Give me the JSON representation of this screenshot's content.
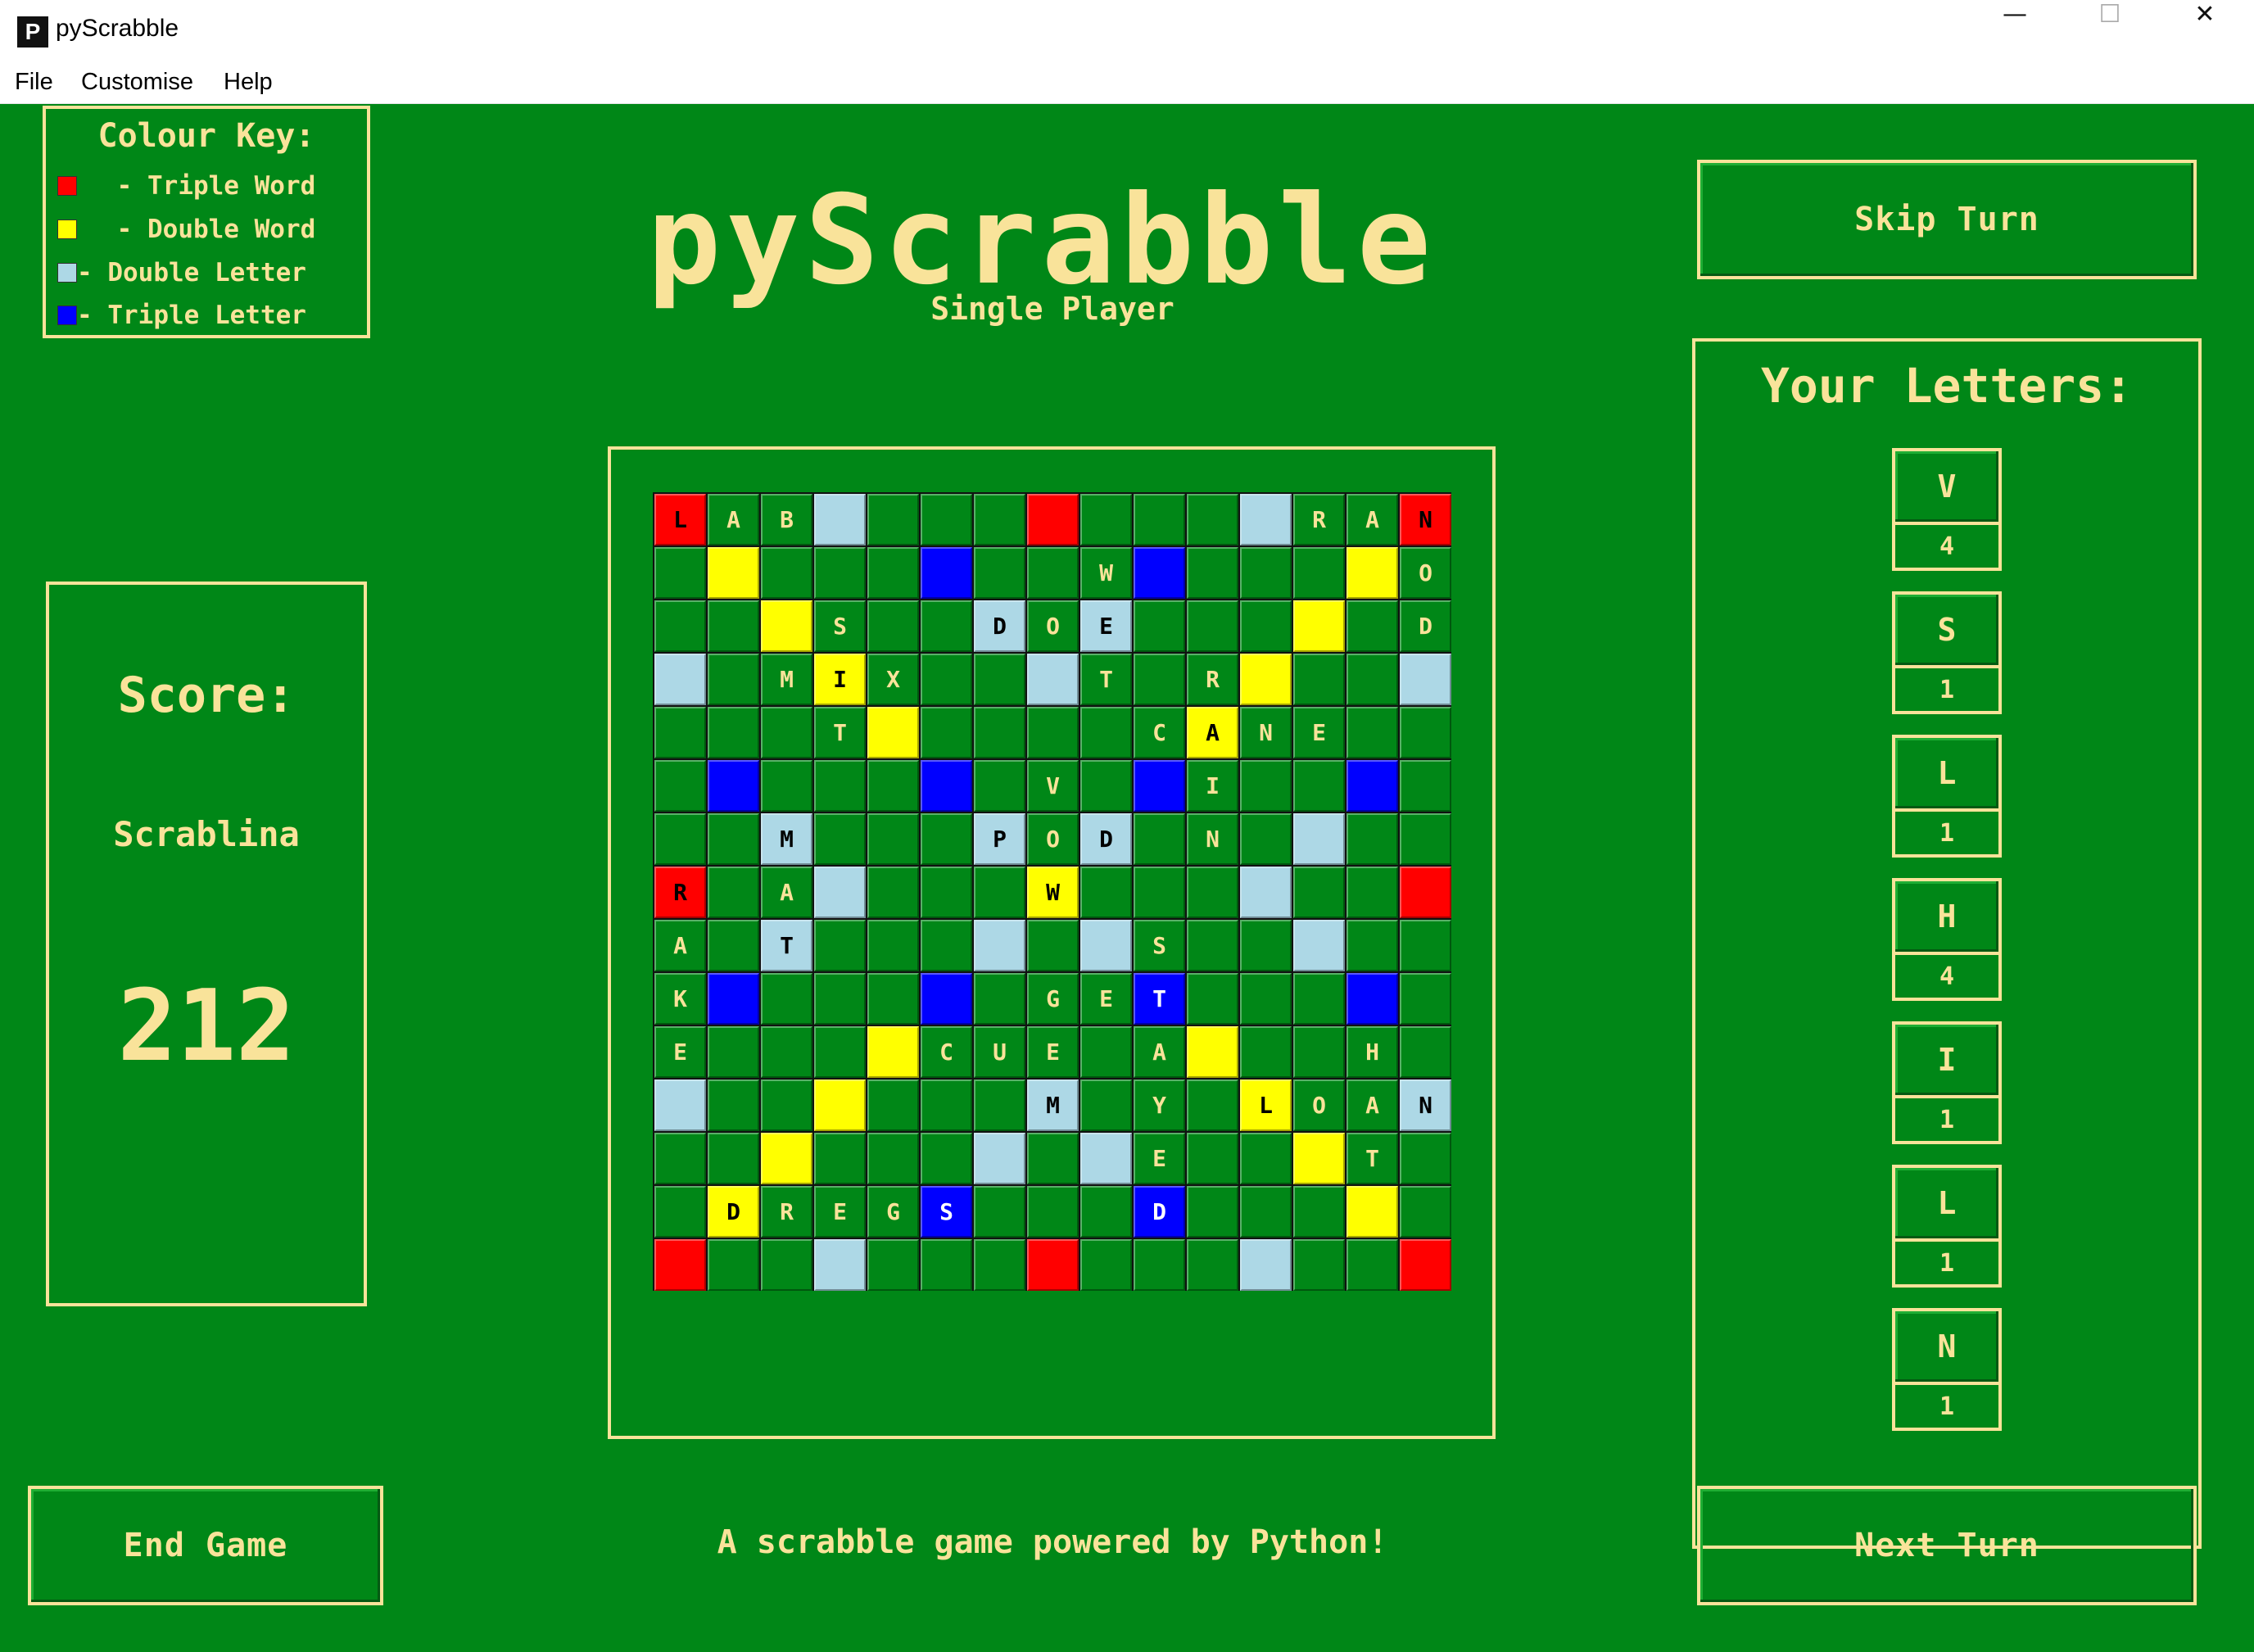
{
  "window": {
    "title": "pyScrabble",
    "icon_letter": "P",
    "controls": {
      "minimize": "—",
      "maximize": "☐",
      "close": "✕"
    }
  },
  "menu": {
    "items": [
      "File",
      "Customise",
      "Help"
    ]
  },
  "colour_key": {
    "title": "Colour Key:",
    "items": [
      {
        "label": " - Triple Word",
        "color": "#ff0000"
      },
      {
        "label": " - Double Word",
        "color": "#ffff00"
      },
      {
        "label": "- Double Letter",
        "color": "#add8e6"
      },
      {
        "label": "- Triple Letter",
        "color": "#0000ff"
      }
    ]
  },
  "header": {
    "title": "pyScrabble",
    "subtitle": "Single Player"
  },
  "score": {
    "label": "Score:",
    "player": "Scrablina",
    "value": "212"
  },
  "buttons": {
    "skip_turn": "Skip Turn",
    "end_game": "End Game",
    "next_turn": "Next Turn"
  },
  "letters": {
    "title": "Your Letters:",
    "tiles": [
      {
        "letter": "V",
        "score": "4"
      },
      {
        "letter": "S",
        "score": "1"
      },
      {
        "letter": "L",
        "score": "1"
      },
      {
        "letter": "H",
        "score": "4"
      },
      {
        "letter": "I",
        "score": "1"
      },
      {
        "letter": "L",
        "score": "1"
      },
      {
        "letter": "N",
        "score": "1"
      }
    ]
  },
  "footer": {
    "text": "A scrabble game powered by Python!"
  },
  "colors": {
    "background": "#008717",
    "cream": "#f9e39a",
    "cell_green": "#008717",
    "triple_word": "#ff0000",
    "double_word": "#ffff00",
    "double_letter": "#add8e6",
    "triple_letter": "#0000ff"
  },
  "board": {
    "rows": [
      "LAB...........RAN",
      "...............",
      "...............",
      "...............",
      "...............",
      "...............",
      "...............",
      "...............",
      "...............",
      "...............",
      "...............",
      "...............",
      "...............",
      "...............",
      "..............."
    ],
    "premium": [
      "T..d...T...d..T",
      ".D...t...t...D.",
      "..D...d.d...D..",
      "d..D...d...D..d",
      "....D.....D....",
      ".t...t...t...t.",
      "..d...d.d...d..",
      "T..d...D...d..T",
      "..d...d.d...d..",
      ".t...t...t...t.",
      "....D.....D....",
      "d..D...d...D..d",
      "..D...d.d...D..",
      ".D...t...t...D.",
      "T..d...T...d..T"
    ],
    "letters": [
      [
        "L",
        "A",
        "B",
        "",
        "",
        "",
        "",
        "",
        "",
        "",
        "",
        "",
        "R",
        "A",
        "N"
      ],
      [
        "",
        "",
        "",
        "",
        "",
        "",
        "",
        "",
        "W",
        "",
        "",
        "",
        "",
        "",
        "O"
      ],
      [
        "",
        "",
        "",
        "S",
        "",
        "",
        "D",
        "O",
        "E",
        "",
        "",
        "",
        "",
        "",
        "D"
      ],
      [
        "",
        "",
        "M",
        "I",
        "X",
        "",
        "",
        "",
        "T",
        "",
        "R",
        "",
        "",
        "",
        ""
      ],
      [
        "",
        "",
        "",
        "T",
        "",
        "",
        "",
        "",
        "",
        "C",
        "A",
        "N",
        "E",
        "",
        ""
      ],
      [
        "",
        "",
        "",
        "",
        "",
        "",
        "",
        "V",
        "",
        "",
        "I",
        "",
        "",
        "",
        ""
      ],
      [
        "",
        "",
        "M",
        "",
        "",
        "",
        "P",
        "O",
        "D",
        "",
        "N",
        "",
        "",
        "",
        ""
      ],
      [
        "R",
        "",
        "A",
        "",
        "",
        "",
        "",
        "W",
        "",
        "",
        "",
        "",
        "",
        "",
        ""
      ],
      [
        "A",
        "",
        "T",
        "",
        "",
        "",
        "",
        "",
        "",
        "S",
        "",
        "",
        "",
        "",
        ""
      ],
      [
        "K",
        "",
        "",
        "",
        "",
        "",
        "",
        "G",
        "E",
        "T",
        "",
        "",
        "",
        "",
        ""
      ],
      [
        "E",
        "",
        "",
        "",
        "",
        "C",
        "U",
        "E",
        "",
        "A",
        "",
        "",
        "",
        "H",
        ""
      ],
      [
        "",
        "",
        "",
        "",
        "",
        "",
        "",
        "M",
        "",
        "Y",
        "",
        "L",
        "O",
        "A",
        "N"
      ],
      [
        "",
        "",
        "",
        "",
        "",
        "",
        "",
        "",
        "",
        "E",
        "",
        "",
        "",
        "T",
        ""
      ],
      [
        "",
        "D",
        "R",
        "E",
        "G",
        "S",
        "",
        "",
        "",
        "D",
        "",
        "",
        "",
        "",
        ""
      ],
      [
        "",
        "",
        "",
        "",
        "",
        "",
        "",
        "",
        "",
        "",
        "",
        "",
        "",
        "",
        ""
      ]
    ]
  }
}
